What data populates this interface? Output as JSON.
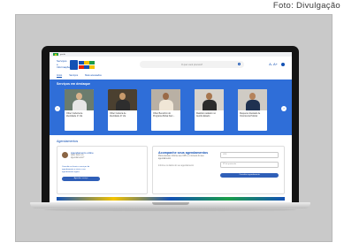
{
  "credit": "Foto: Divulgação",
  "gov_bar": {
    "label": "gov.br"
  },
  "header": {
    "site_name": "Serviços e Informações",
    "search_placeholder": "O que você procura?",
    "icons": [
      "contrast-icon",
      "font-size-icon",
      "dark-mode-icon"
    ],
    "icon_text": "A- A+"
  },
  "nav": [
    "Início",
    "Serviços",
    "Mais acessados"
  ],
  "hero": {
    "title": "Serviços em destaque",
    "cards": [
      {
        "label": "Obter Carteira de Identidade 1ª Via",
        "img_bg": "#6b7c6e",
        "skin": "#d9b38c",
        "shirt": "#e6e6e6"
      },
      {
        "label": "Obter Carteira de Identidade 2ª Via",
        "img_bg": "#4b4030",
        "skin": "#c79a6b",
        "shirt": "#2e2e2e"
      },
      {
        "label": "Obter Benefício do Programa Bolsa Fam…",
        "img_bg": "#b9b0a4",
        "skin": "#9a6a47",
        "shirt": "#f0e6d6"
      },
      {
        "label": "Realizar cadastro no Auxílio Estado",
        "img_bg": "#d7d2cb",
        "skin": "#a7764f",
        "shirt": "#2b2b2b"
      },
      {
        "label": "Requerer Atestado de Ocorrência Policial",
        "img_bg": "#cfcbc4",
        "skin": "#b5835b",
        "shirt": "#1f3150"
      }
    ]
  },
  "appointments": {
    "section_title": "Agendamentos",
    "online": {
      "title": "Agendamento online",
      "subtitle": "Quer fazer um agendamento?",
      "description": "Consulte os locais e serviços de agendamento e inicie o seu agendamento agora.",
      "button": "Agendar serviço"
    },
    "track": {
      "title": "Acompanhe seus agendamentos",
      "description": "Para acessar, informe seu CPF e o número do seu agendamento.",
      "note": "Informe os dados do seu agendamento",
      "cpf_placeholder": "CPF",
      "number_placeholder": "Nº do protocolo",
      "button": "Consultar agendamento"
    }
  },
  "logo_colors": [
    "#1351b4",
    "#f3c300",
    "#1a9d49",
    "#e52207",
    "#1351b4",
    "#f3c300"
  ]
}
